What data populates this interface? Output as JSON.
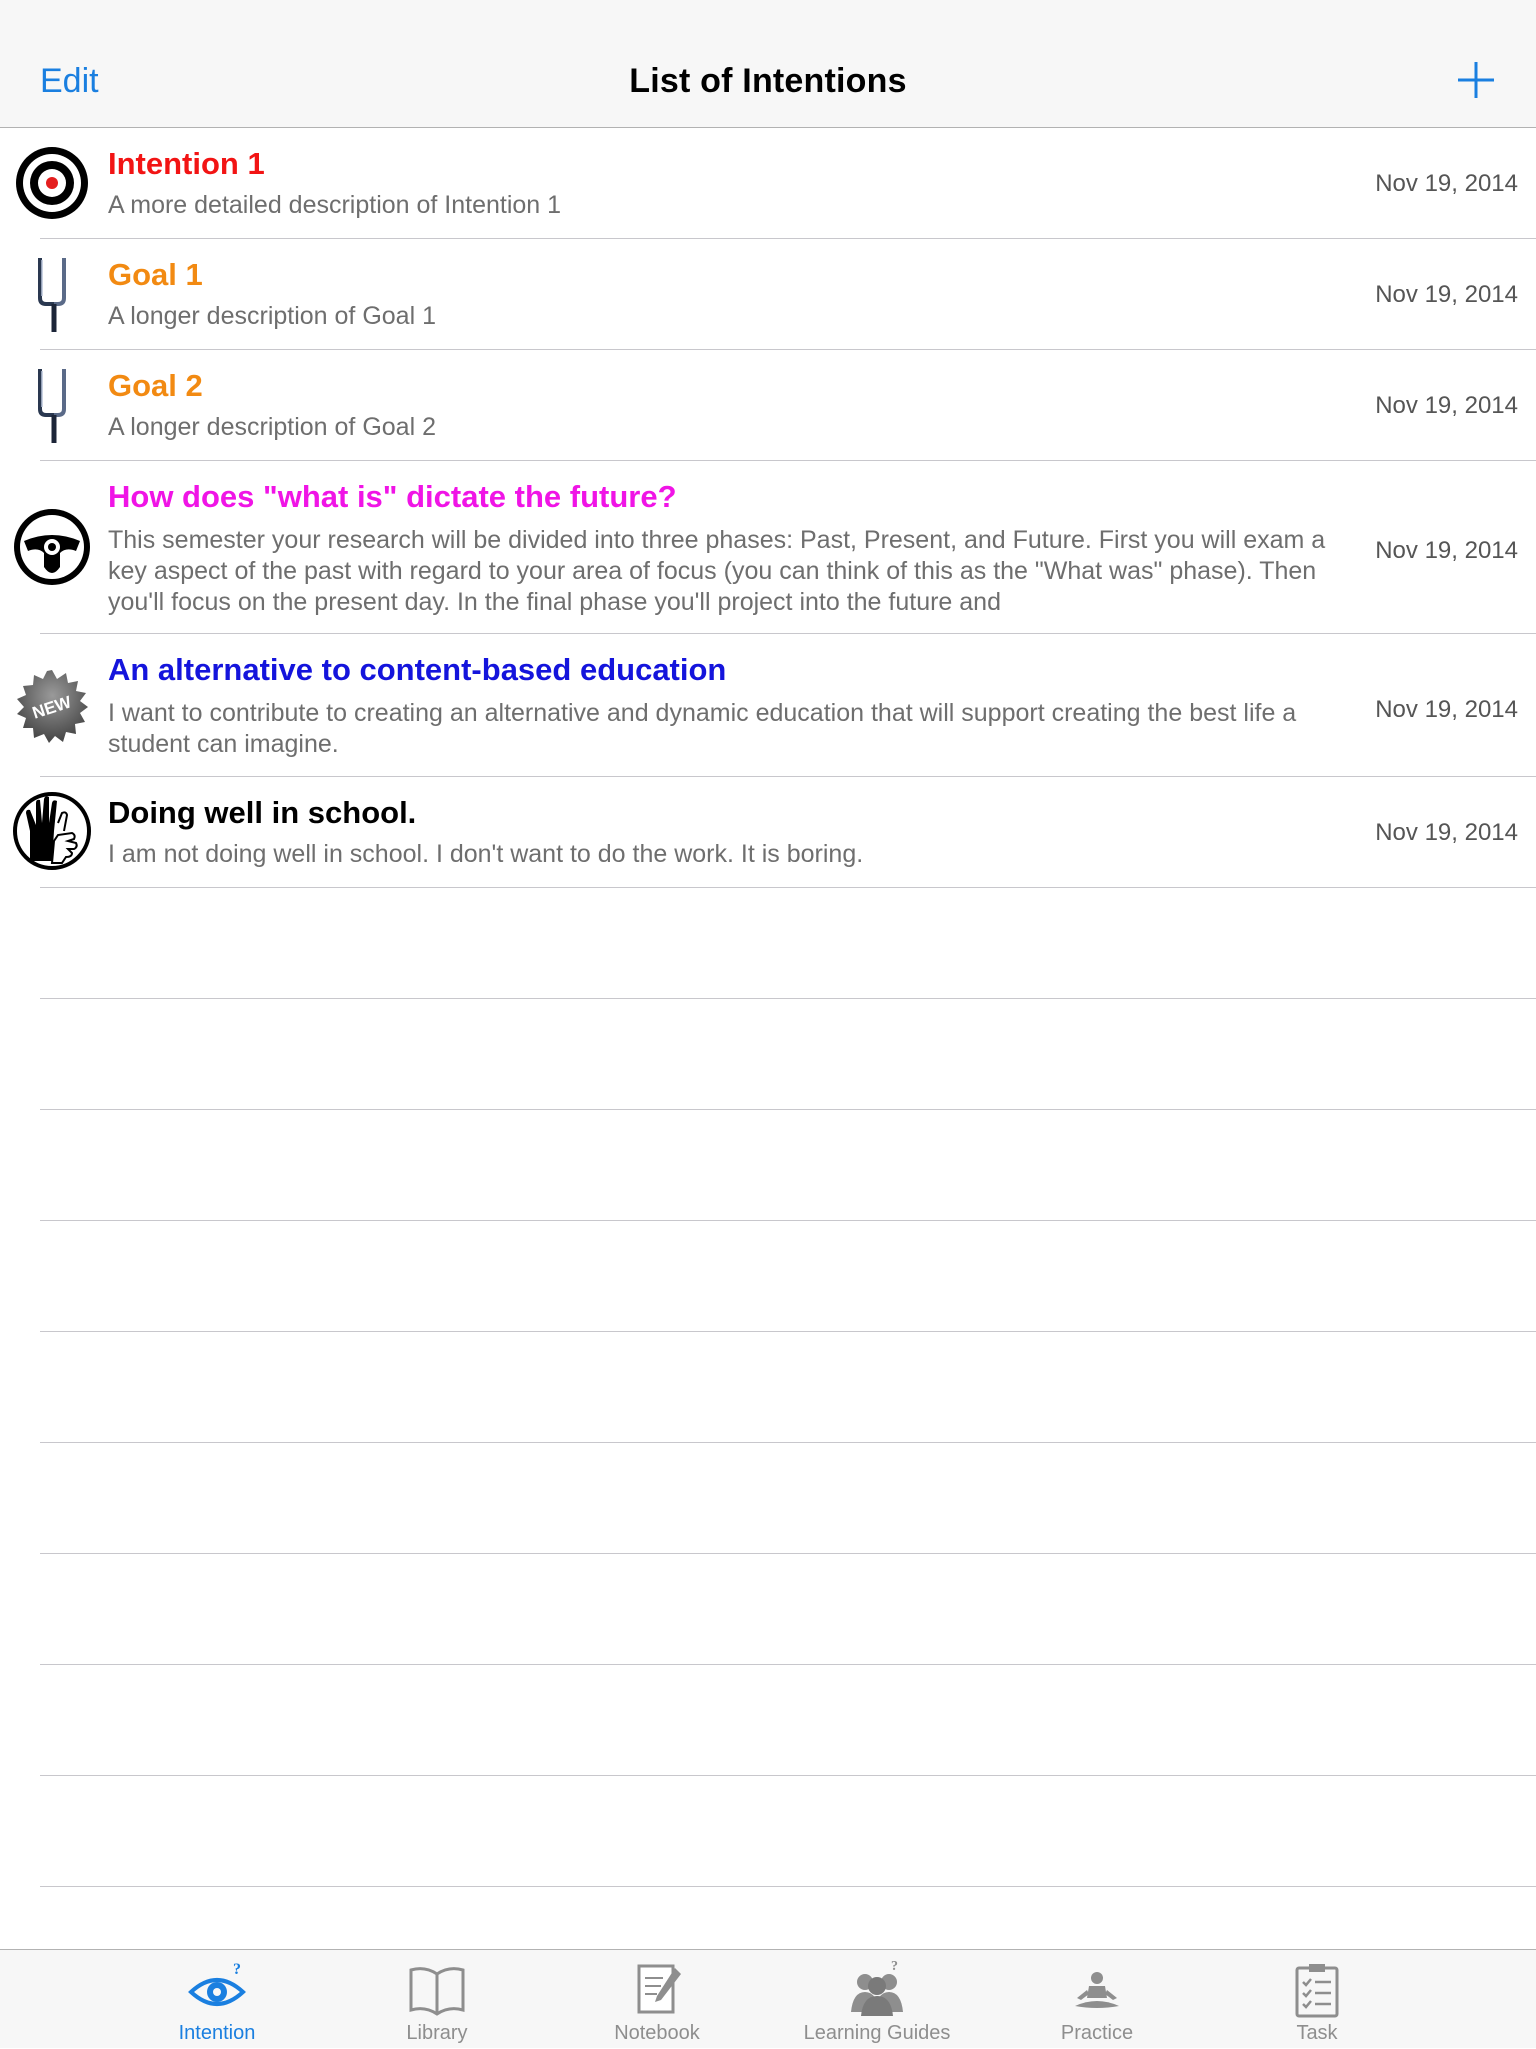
{
  "navbar": {
    "edit_label": "Edit",
    "title": "List of Intentions",
    "add_icon": "plus-icon"
  },
  "colors": {
    "accent": "#1a7fe0",
    "red": "#f21414",
    "orange": "#f28a12",
    "magenta": "#f014e6",
    "blue": "#1414dc",
    "black": "#000000"
  },
  "intentions": [
    {
      "icon": "target-icon",
      "title": "Intention 1",
      "title_color": "#f21414",
      "description": "A more detailed description of Intention 1",
      "date": "Nov 19, 2014"
    },
    {
      "icon": "goalpost-icon",
      "title": "Goal 1",
      "title_color": "#f28a12",
      "description": "A longer description of Goal 1",
      "date": "Nov 19, 2014"
    },
    {
      "icon": "goalpost-icon",
      "title": "Goal 2",
      "title_color": "#f28a12",
      "description": "A longer description of Goal 2",
      "date": "Nov 19, 2014"
    },
    {
      "icon": "steering-wheel-icon",
      "title": "How does \"what is\" dictate the future?",
      "title_color": "#f014e6",
      "description": "This semester your research will be divided into three phases: Past, Present, and Future. First you will exam a key aspect of the past with regard to your area of focus (you can think of this as the \"What was\" phase). Then you'll focus on the present day. In the final phase you'll project into the future and",
      "date": "Nov 19, 2014"
    },
    {
      "icon": "new-badge-icon",
      "icon_text": "NEW",
      "title": "An alternative to content-based education",
      "title_color": "#1414dc",
      "description": "I want to contribute to creating an alternative and dynamic education that will support creating the best life a student can imagine.",
      "date": "Nov 19, 2014"
    },
    {
      "icon": "raised-hands-icon",
      "title": "Doing well in school.",
      "title_color": "#000000",
      "description": "I am not doing well in school.  I don't want to do the work.  It is boring.",
      "date": "Nov 19, 2014"
    }
  ],
  "tabbar": {
    "tabs": [
      {
        "label": "Intention",
        "icon": "eye-question-icon",
        "active": true
      },
      {
        "label": "Library",
        "icon": "open-book-icon",
        "active": false
      },
      {
        "label": "Notebook",
        "icon": "notebook-pencil-icon",
        "active": false
      },
      {
        "label": "Learning Guides",
        "icon": "people-group-icon",
        "active": false
      },
      {
        "label": "Practice",
        "icon": "meditation-icon",
        "active": false
      },
      {
        "label": "Task",
        "icon": "clipboard-checklist-icon",
        "active": false
      }
    ]
  }
}
